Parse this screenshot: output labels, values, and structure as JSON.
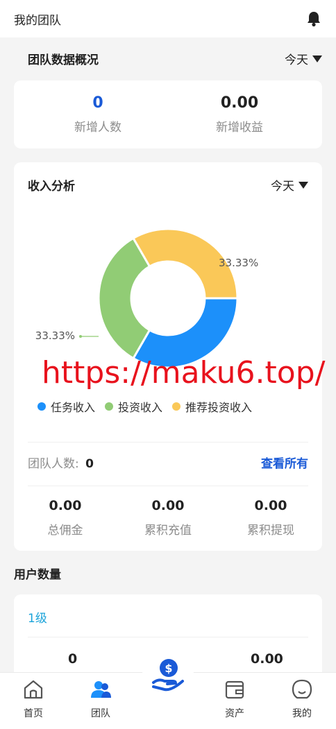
{
  "header": {
    "title": "我的团队",
    "bell_icon": "bell-icon"
  },
  "overview": {
    "title": "团队数据概况",
    "period": "今天",
    "new_members": {
      "value": "0",
      "label": "新增人数"
    },
    "new_income": {
      "value": "0.00",
      "label": "新增收益"
    }
  },
  "income": {
    "title": "收入分析",
    "period": "今天",
    "team_label": "团队人数:",
    "team_count": "0",
    "view_all": "查看所有",
    "stats": [
      {
        "value": "0.00",
        "label": "总佣金"
      },
      {
        "value": "0.00",
        "label": "累积充值"
      },
      {
        "value": "0.00",
        "label": "累积提现"
      }
    ]
  },
  "chart_data": {
    "type": "pie",
    "categories": [
      "任务收入",
      "投资收入",
      "推荐投资收入"
    ],
    "values": [
      33.33,
      33.33,
      33.33
    ],
    "labels": [
      "33.33%",
      "33.33%",
      "33.33%"
    ],
    "colors": [
      "#1c90fa",
      "#91cc75",
      "#fac858"
    ],
    "legend_position": "bottom-left"
  },
  "users": {
    "title": "用户数量",
    "level": "1级",
    "left_value": "0",
    "right_value": "0.00"
  },
  "watermark": "https://maku6.top/",
  "nav": {
    "items": [
      {
        "label": "首页",
        "icon": "home-icon"
      },
      {
        "label": "团队",
        "icon": "team-icon"
      },
      {
        "label": "资产",
        "icon": "wallet-icon"
      },
      {
        "label": "我的",
        "icon": "profile-icon"
      }
    ],
    "center_icon": "dollar-hand-icon"
  },
  "colors": {
    "accent": "#1a5ad7",
    "level": "#1aa3d9",
    "watermark": "#e8121d"
  }
}
